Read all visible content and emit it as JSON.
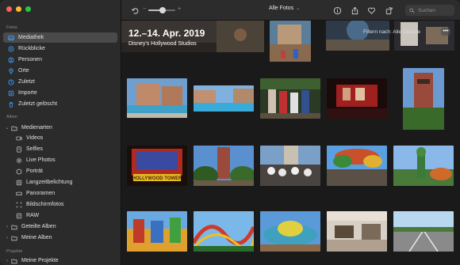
{
  "sidebar": {
    "section_fotos": "Fotos",
    "section_alben": "Alben",
    "section_projekte": "Projekte",
    "items_fotos": [
      {
        "label": "Mediathek",
        "icon": "library-icon"
      },
      {
        "label": "Rückblicke",
        "icon": "memories-icon"
      },
      {
        "label": "Personen",
        "icon": "people-icon"
      },
      {
        "label": "Orte",
        "icon": "places-icon"
      },
      {
        "label": "Zuletzt",
        "icon": "recent-icon"
      },
      {
        "label": "Importe",
        "icon": "imports-icon"
      },
      {
        "label": "Zuletzt gelöscht",
        "icon": "trash-icon"
      }
    ],
    "medienarten": "Medienarten",
    "media_types": [
      {
        "label": "Videos",
        "icon": "video-icon"
      },
      {
        "label": "Selfies",
        "icon": "selfie-icon"
      },
      {
        "label": "Live Photos",
        "icon": "live-photo-icon"
      },
      {
        "label": "Porträt",
        "icon": "portrait-icon"
      },
      {
        "label": "Langzeitbelichtung",
        "icon": "long-exposure-icon"
      },
      {
        "label": "Panoramen",
        "icon": "panorama-icon"
      },
      {
        "label": "Bildschirmfotos",
        "icon": "screenshot-icon"
      },
      {
        "label": "RAW",
        "icon": "raw-icon"
      }
    ],
    "geteilte_alben": "Geteilte Alben",
    "meine_alben": "Meine Alben",
    "meine_projekte": "Meine Projekte"
  },
  "toolbar": {
    "zoom_minus": "−",
    "zoom_plus": "+",
    "view_selector": "Alle Fotos",
    "search_placeholder": "Suchen",
    "zoom_level": 0.55
  },
  "content": {
    "date_title": "12.–14. Apr. 2019",
    "location": "Disney's Hollywood Studios",
    "filter_label": "Filtern nach: Alle Objekte",
    "more_button": "•••"
  },
  "colors": {
    "accent": "#2f7bf6",
    "sidebar_icon": "#3aa0ff",
    "selected_row": "#4a4a4a"
  }
}
